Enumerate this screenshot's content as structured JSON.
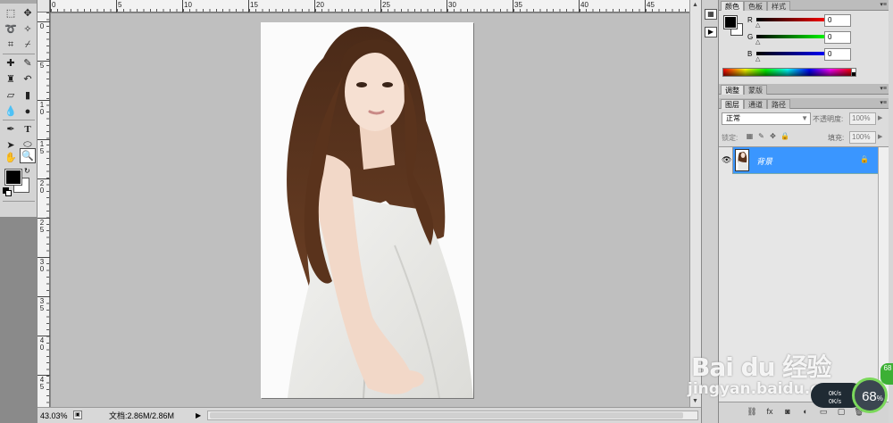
{
  "status": {
    "zoom": "43.03%",
    "doc_info": "文档:2.86M/2.86M"
  },
  "rulers": {
    "top_labels": [
      "0",
      "5",
      "10",
      "15",
      "20",
      "25",
      "30",
      "35",
      "40",
      "45"
    ],
    "left_labels": [
      "0",
      "5",
      "1 0",
      "1 5",
      "2 0",
      "2 5",
      "3 0",
      "3 5",
      "4 0",
      "4 5"
    ]
  },
  "color_panel": {
    "tabs": [
      "颜色",
      "色板",
      "样式"
    ],
    "channels": [
      {
        "label": "R",
        "value": "0"
      },
      {
        "label": "G",
        "value": "0"
      },
      {
        "label": "B",
        "value": "0"
      }
    ]
  },
  "adjust_panel": {
    "tabs": [
      "调整",
      "蒙版"
    ]
  },
  "layers_panel": {
    "tabs": [
      "图层",
      "通道",
      "路径"
    ],
    "blend_mode": "正常",
    "opacity_label": "不透明度:",
    "opacity_value": "100%",
    "lock_label": "锁定:",
    "fill_label": "填充:",
    "fill_value": "100%",
    "layers": [
      {
        "name": "背景",
        "visible": true,
        "locked": true
      }
    ]
  },
  "watermark": {
    "logo": "Bai du 经验",
    "site": "jingyan.baidu.com"
  },
  "speed_widget": {
    "percent": "68",
    "rate1": "0K/s",
    "rate2": "0K/s",
    "badge": "68"
  },
  "colors": {
    "selected_layer": "#3a96ff",
    "pasteboard": "#bfbfbf",
    "accent_green": "#7bd85b"
  }
}
